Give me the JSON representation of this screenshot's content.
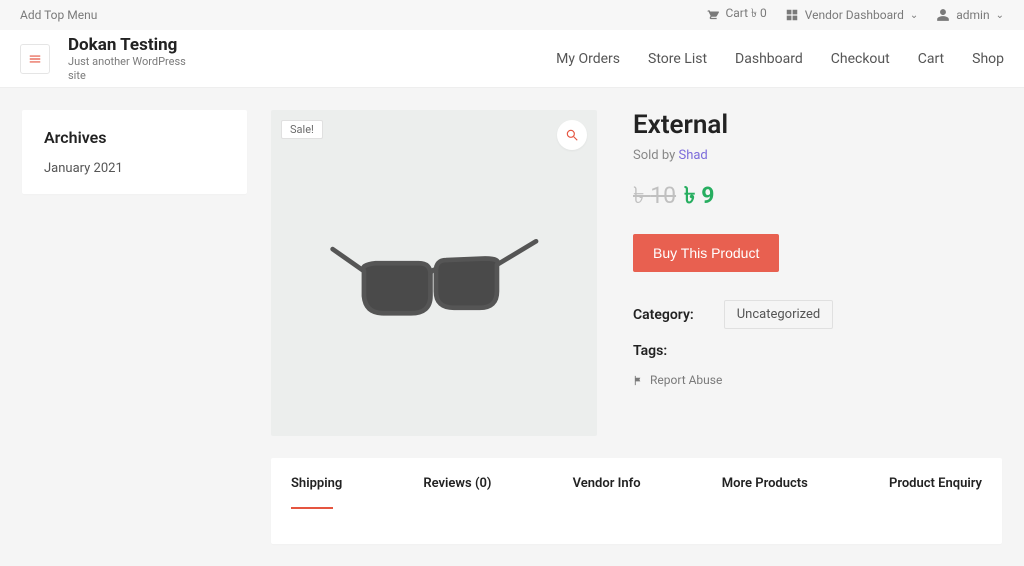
{
  "topbar": {
    "left_link": "Add Top Menu",
    "cart_label": "Cart ৳ 0",
    "vendor_label": "Vendor Dashboard",
    "user_label": "admin"
  },
  "brand": {
    "title": "Dokan Testing",
    "tagline": "Just another WordPress site"
  },
  "nav": {
    "items": [
      "My Orders",
      "Store List",
      "Dashboard",
      "Checkout",
      "Cart",
      "Shop"
    ]
  },
  "sidebar": {
    "title": "Archives",
    "items": [
      "January 2021"
    ]
  },
  "product": {
    "sale_badge": "Sale!",
    "title": "External",
    "sold_by_label": "Sold by",
    "vendor": "Shad",
    "currency": "৳",
    "price_old": "10",
    "price_new": "9",
    "buy_label": "Buy This Product",
    "category_label": "Category:",
    "category_value": "Uncategorized",
    "tags_label": "Tags:",
    "report_label": "Report Abuse"
  },
  "tabs": {
    "items": [
      "Shipping",
      "Reviews (0)",
      "Vendor Info",
      "More Products",
      "Product Enquiry"
    ],
    "active_index": 0
  }
}
